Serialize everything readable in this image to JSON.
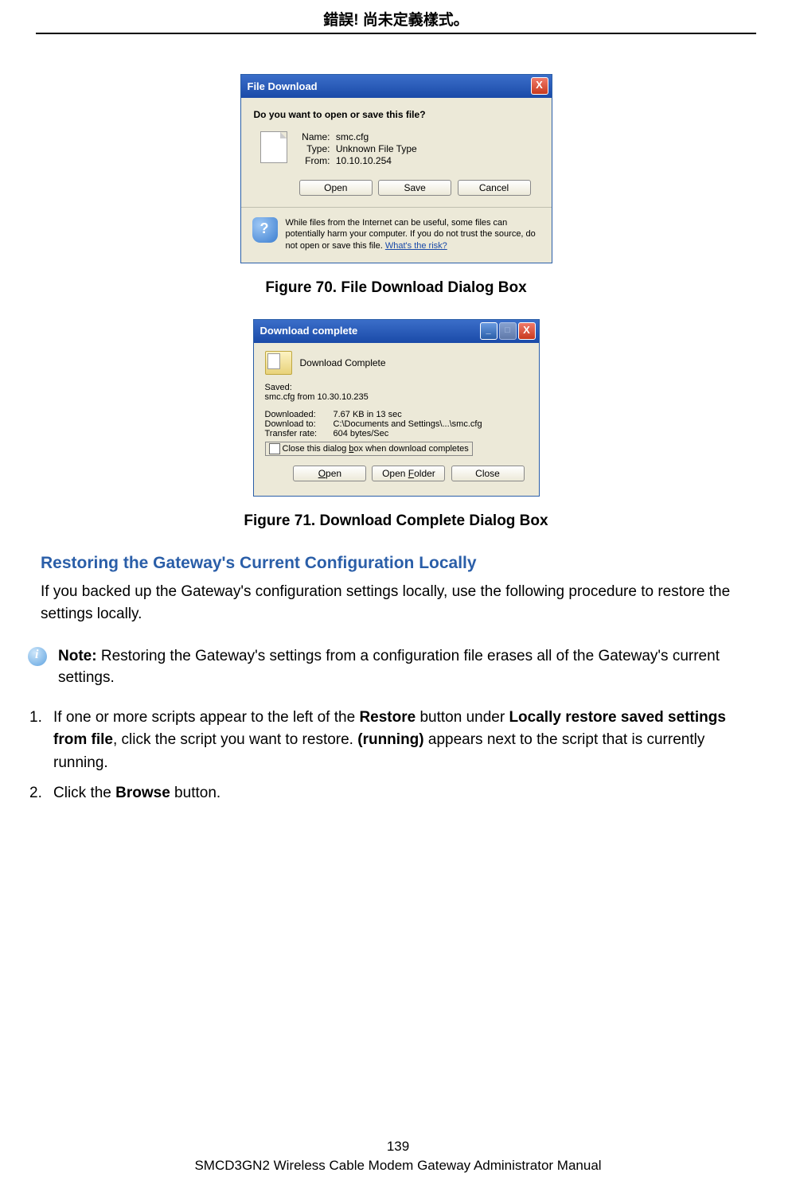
{
  "header": {
    "text": "錯誤! 尚未定義樣式。"
  },
  "dialog1": {
    "title": "File Download",
    "close": "X",
    "prompt": "Do you want to open or save this file?",
    "name_label": "Name:",
    "name_value": "smc.cfg",
    "type_label": "Type:",
    "type_value": "Unknown File Type",
    "from_label": "From:",
    "from_value": "10.10.10.254",
    "open_btn": "Open",
    "save_btn": "Save",
    "cancel_btn": "Cancel",
    "warning_text": "While files from the Internet can be useful, some files can potentially harm your computer. If you do not trust the source, do not open or save this file. ",
    "risk_link": "What's the risk?"
  },
  "caption1": "Figure 70. File Download Dialog Box",
  "dialog2": {
    "title": "Download complete",
    "complete_label": "Download Complete",
    "saved_label": "Saved:",
    "saved_value": "smc.cfg from 10.30.10.235",
    "downloaded_label": "Downloaded:",
    "downloaded_value": "7.67 KB in 13 sec",
    "download_to_label": "Download to:",
    "download_to_value": "C:\\Documents and Settings\\...\\smc.cfg",
    "transfer_label": "Transfer rate:",
    "transfer_value": "604 bytes/Sec",
    "checkbox_pre": "Close this dialog ",
    "checkbox_u": "b",
    "checkbox_post": "ox when download completes",
    "open_btn_u": "O",
    "open_btn_post": "pen",
    "open_folder_pre": "Open ",
    "open_folder_u": "F",
    "open_folder_post": "older",
    "close_btn": "Close"
  },
  "caption2": "Figure 71. Download Complete Dialog Box",
  "section_heading": "Restoring the Gateway's Current Configuration Locally",
  "para1": "If you backed up the Gateway's configuration settings locally, use the following procedure to restore the settings locally.",
  "note_label": "Note:",
  "note_text": " Restoring the Gateway's settings from a configuration file erases all of the Gateway's current settings.",
  "step1_pre": "If one or more scripts appear to the left of the ",
  "step1_b1": "Restore",
  "step1_mid1": " button under ",
  "step1_b2": "Locally restore saved settings from file",
  "step1_mid2": ", click the script you want to restore. ",
  "step1_b3": "(running)",
  "step1_post": " appears next to the script that is currently running.",
  "step2_pre": "Click the ",
  "step2_b1": "Browse",
  "step2_post": " button.",
  "footer": {
    "page_number": "139",
    "manual_title": "SMCD3GN2 Wireless Cable Modem Gateway Administrator Manual"
  }
}
